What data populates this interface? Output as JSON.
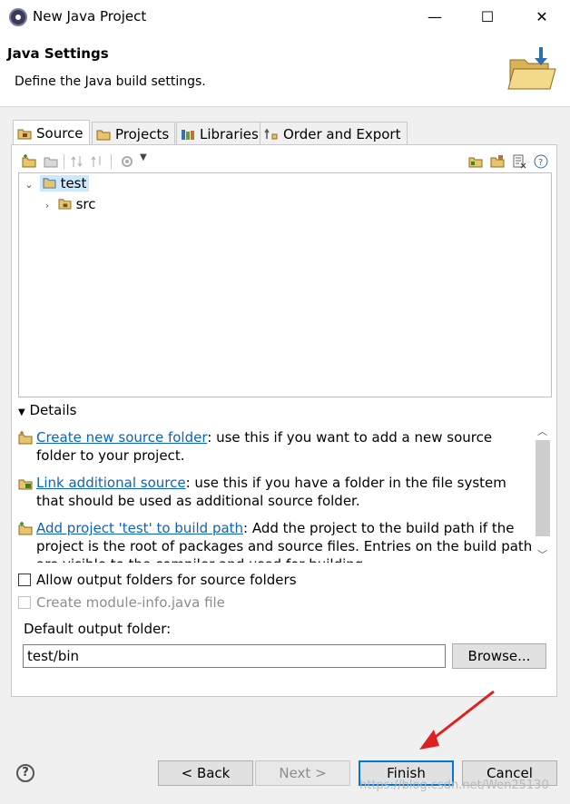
{
  "window": {
    "title": "New Java Project",
    "minimize": "—",
    "maximize": "☐",
    "close": "✕"
  },
  "header": {
    "title": "Java Settings",
    "description": "Define the Java build settings."
  },
  "tabs": [
    {
      "label": "Source"
    },
    {
      "label": "Projects"
    },
    {
      "label": "Libraries"
    },
    {
      "label": "Order and Export"
    }
  ],
  "tree": {
    "root": "test",
    "child": "src"
  },
  "details": {
    "heading": "Details",
    "items": [
      {
        "link": "Create new source folder",
        "text": ": use this if you want to add a new source folder to your project."
      },
      {
        "link": "Link additional source",
        "text": ": use this if you have a folder in the file system that should be used as additional source folder."
      },
      {
        "link": "Add project 'test' to build path",
        "text": ": Add the project to the build path if the project is the root of packages and source files. Entries on the build path are visible to the compiler and used for building."
      }
    ]
  },
  "options": {
    "allow_output_folders": "Allow output folders for source folders",
    "create_module_info": "Create module-info.java file"
  },
  "output": {
    "label": "Default output folder:",
    "value": "test/bin",
    "browse": "Browse..."
  },
  "buttons": {
    "back": "< Back",
    "next": "Next >",
    "finish": "Finish",
    "cancel": "Cancel",
    "help": "?"
  },
  "watermark": "https://blog.csdn.net/Wen25130",
  "colors": {
    "link": "#0a63c6",
    "selection": "#cce8ff",
    "annotation_arrow": "#e02020",
    "default_button_border": "#0078d7"
  }
}
